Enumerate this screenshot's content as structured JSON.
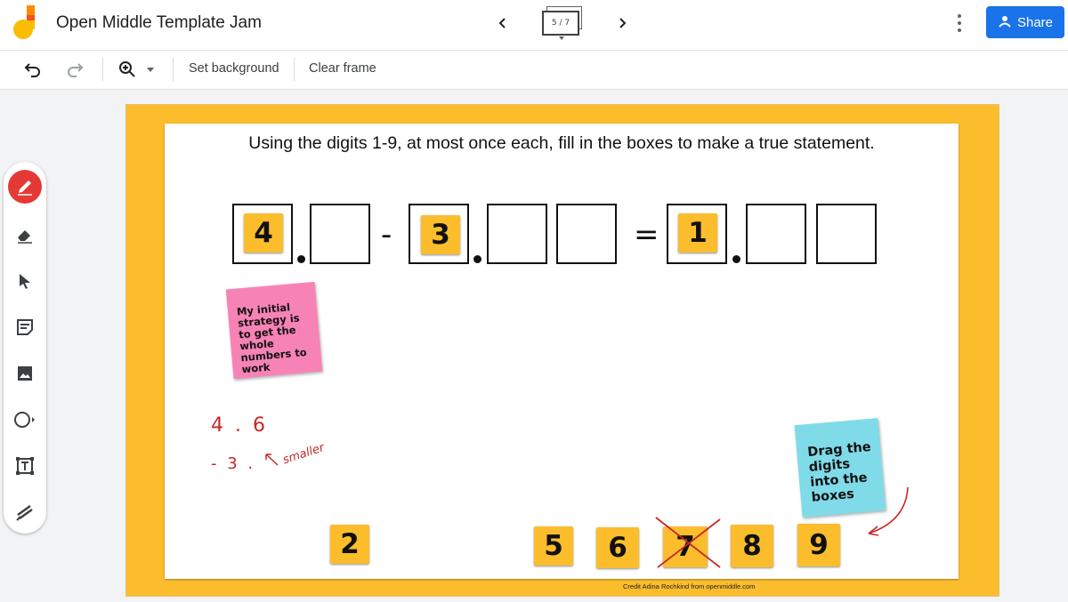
{
  "app": {
    "title": "Open Middle Template Jam",
    "frame_indicator": "5 / 7",
    "share_label": "Share"
  },
  "toolbar": {
    "set_background": "Set background",
    "clear_frame": "Clear frame"
  },
  "tools": [
    "pen-icon",
    "eraser-icon",
    "select-icon",
    "sticky-note-icon",
    "image-icon",
    "circle-icon",
    "text-box-icon",
    "laser-icon"
  ],
  "canvas": {
    "question": "Using the digits 1-9, at most once each, fill in the boxes to make a true statement.",
    "operators": {
      "minus": "-",
      "equals": "="
    },
    "placed_digits": [
      "4",
      "3",
      "1"
    ],
    "tray_digits": [
      "2",
      "5",
      "6",
      "7",
      "8",
      "9"
    ],
    "crossed_digit": "7",
    "sticky_pink": "My initial strategy is to get the whole numbers to work",
    "sticky_cyan": "Drag the digits into the boxes",
    "handwriting": {
      "line1": "4 . 6",
      "line2": "- 3 .",
      "note": "smaller"
    },
    "credit": "Credit Adina Rochkind from openmiddle.com"
  },
  "colors": {
    "accent": "#1a73e8",
    "frame": "#fbbd2c",
    "tile": "#fbbd2c",
    "pink_note": "#f783b6",
    "cyan_note": "#80dbe9",
    "ink": "#c62828",
    "active_tool": "#e53935"
  }
}
